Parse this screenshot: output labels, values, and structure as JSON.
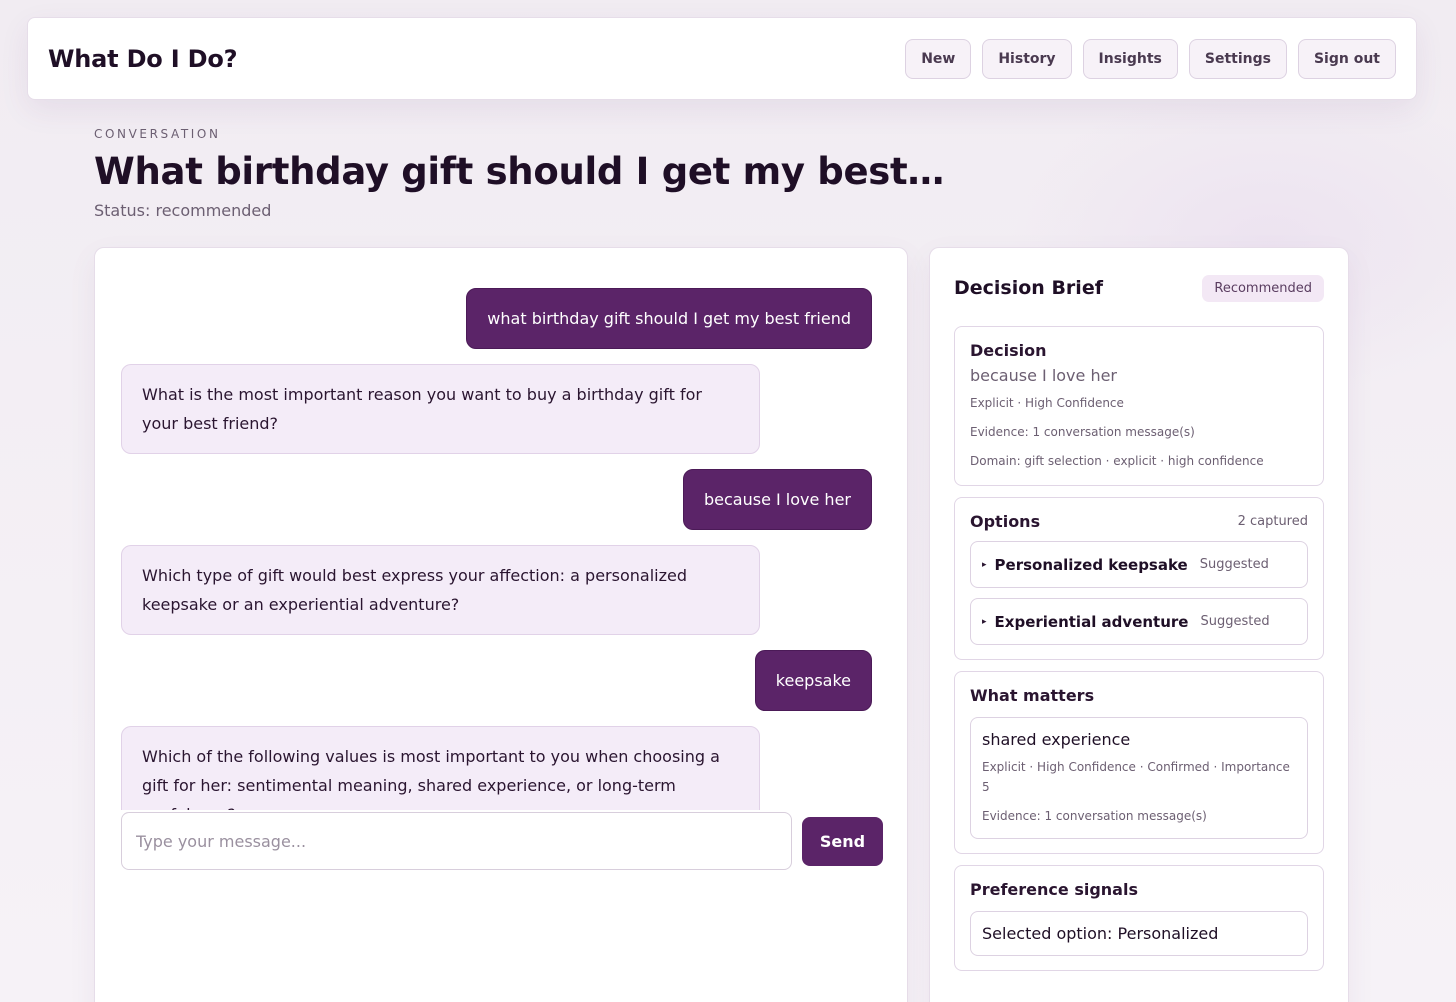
{
  "app": {
    "brand": "What Do I Do?",
    "nav": [
      "New",
      "History",
      "Insights",
      "Settings",
      "Sign out"
    ]
  },
  "header": {
    "eyebrow": "CONVERSATION",
    "title": "What birthday gift should I get my best…",
    "status": "Status: recommended"
  },
  "chat": {
    "messages": [
      {
        "role": "user",
        "text": "what birthday gift should I get my best friend"
      },
      {
        "role": "assistant",
        "text": "What is the most important reason you want to buy a birthday gift for your best friend?"
      },
      {
        "role": "user",
        "text": "because I love her"
      },
      {
        "role": "assistant",
        "text": "Which type of gift would best express your affection: a personalized keepsake or an experiential adventure?"
      },
      {
        "role": "user",
        "text": "keepsake"
      },
      {
        "role": "assistant",
        "text": "Which of the following values is most important to you when choosing a gift for her: sentimental meaning, shared experience, or long-term usefulness?"
      }
    ],
    "input_placeholder": "Type your message...",
    "send_label": "Send"
  },
  "brief": {
    "title": "Decision Brief",
    "badge": "Recommended",
    "decision": {
      "heading": "Decision",
      "value": "because I love her",
      "meta": "Explicit · High Confidence",
      "evidence": "Evidence: 1 conversation message(s)",
      "domain": "Domain: gift selection · explicit · high confidence"
    },
    "options": {
      "heading": "Options",
      "count": "2 captured",
      "items": [
        {
          "name": "Personalized keepsake",
          "tag": "Suggested"
        },
        {
          "name": "Experiential adventure",
          "tag": "Suggested"
        }
      ]
    },
    "what_matters": {
      "heading": "What matters",
      "item": {
        "title": "shared experience",
        "meta": "Explicit · High Confidence · Confirmed · Importance 5",
        "evidence": "Evidence: 1 conversation message(s)"
      }
    },
    "preference_signals": {
      "heading": "Preference signals",
      "item": "Selected option: Personalized"
    }
  }
}
